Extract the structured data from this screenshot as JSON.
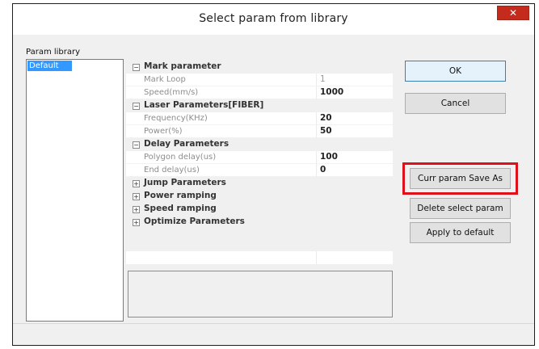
{
  "window": {
    "title": "Select param from library",
    "close_glyph": "✕"
  },
  "library": {
    "label": "Param library",
    "items": [
      "Default"
    ],
    "selected": "Default"
  },
  "params": {
    "mark": {
      "title": "Mark parameter",
      "toggle": "−",
      "rows": [
        {
          "name": "Mark Loop",
          "value": "1"
        },
        {
          "name": "Speed(mm/s)",
          "value": "1000"
        }
      ]
    },
    "laser": {
      "title": "Laser Parameters[FIBER]",
      "toggle": "−",
      "rows": [
        {
          "name": "Frequency(KHz)",
          "value": "20"
        },
        {
          "name": "Power(%)",
          "value": "50"
        }
      ]
    },
    "delay": {
      "title": "Delay Parameters",
      "toggle": "−",
      "rows": [
        {
          "name": "Polygon delay(us)",
          "value": "100"
        },
        {
          "name": "End delay(us)",
          "value": "0"
        }
      ]
    },
    "jump": {
      "title": "Jump Parameters",
      "toggle": "+"
    },
    "power_ramp": {
      "title": "Power ramping",
      "toggle": "+"
    },
    "speed_ramp": {
      "title": "Speed ramping",
      "toggle": "+"
    },
    "optimize": {
      "title": "Optimize Parameters",
      "toggle": "+"
    }
  },
  "buttons": {
    "ok": "OK",
    "cancel": "Cancel",
    "save_as": "Curr param Save As",
    "delete": "Delete select param",
    "apply": "Apply to default"
  },
  "colors": {
    "highlight": "#e0101a",
    "selection": "#3399ff",
    "close": "#c42b1c"
  }
}
